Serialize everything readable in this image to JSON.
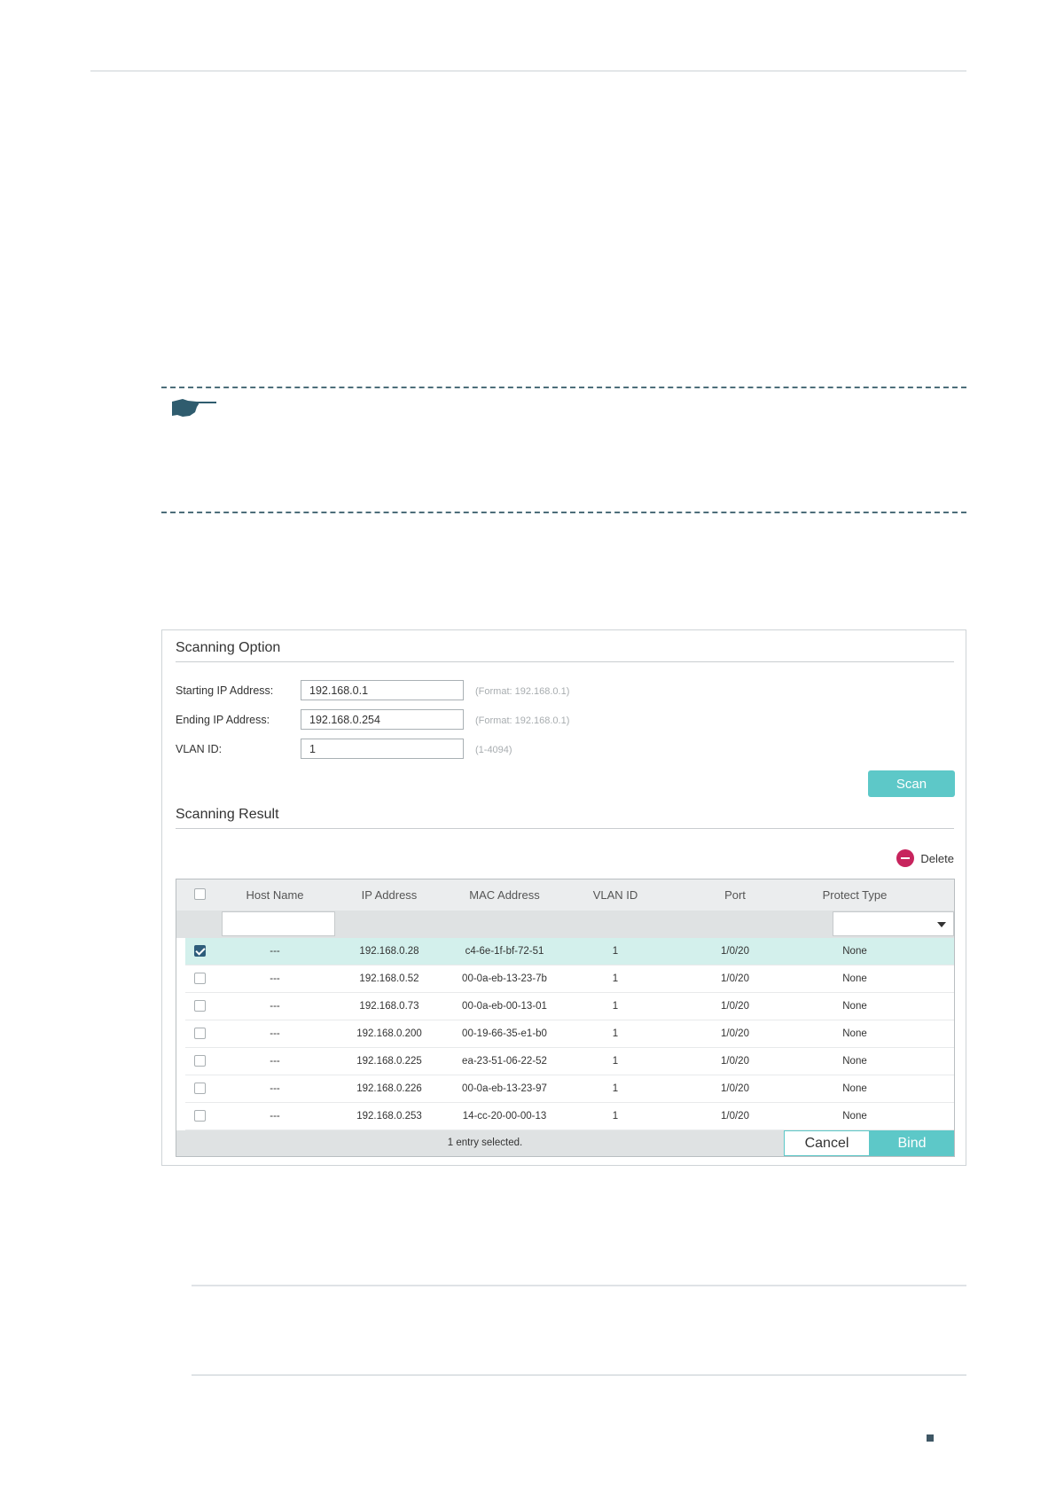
{
  "scanning_option": {
    "title": "Scanning Option",
    "fields": [
      {
        "label": "Starting IP Address:",
        "value": "192.168.0.1",
        "hint": "(Format: 192.168.0.1)"
      },
      {
        "label": "Ending IP Address:",
        "value": "192.168.0.254",
        "hint": "(Format: 192.168.0.1)"
      },
      {
        "label": "VLAN ID:",
        "value": "1",
        "hint": "(1-4094)"
      }
    ],
    "scan_label": "Scan"
  },
  "scanning_result": {
    "title": "Scanning Result",
    "delete_label": "Delete",
    "columns": [
      "Host Name",
      "IP Address",
      "MAC Address",
      "VLAN ID",
      "Port",
      "Protect Type"
    ],
    "rows": [
      {
        "selected": true,
        "host": "---",
        "ip": "192.168.0.28",
        "mac": "c4-6e-1f-bf-72-51",
        "vlan": "1",
        "port": "1/0/20",
        "protect": "None"
      },
      {
        "selected": false,
        "host": "---",
        "ip": "192.168.0.52",
        "mac": "00-0a-eb-13-23-7b",
        "vlan": "1",
        "port": "1/0/20",
        "protect": "None"
      },
      {
        "selected": false,
        "host": "---",
        "ip": "192.168.0.73",
        "mac": "00-0a-eb-00-13-01",
        "vlan": "1",
        "port": "1/0/20",
        "protect": "None"
      },
      {
        "selected": false,
        "host": "---",
        "ip": "192.168.0.200",
        "mac": "00-19-66-35-e1-b0",
        "vlan": "1",
        "port": "1/0/20",
        "protect": "None"
      },
      {
        "selected": false,
        "host": "---",
        "ip": "192.168.0.225",
        "mac": "ea-23-51-06-22-52",
        "vlan": "1",
        "port": "1/0/20",
        "protect": "None"
      },
      {
        "selected": false,
        "host": "---",
        "ip": "192.168.0.226",
        "mac": "00-0a-eb-13-23-97",
        "vlan": "1",
        "port": "1/0/20",
        "protect": "None"
      },
      {
        "selected": false,
        "host": "---",
        "ip": "192.168.0.253",
        "mac": "14-cc-20-00-00-13",
        "vlan": "1",
        "port": "1/0/20",
        "protect": "None"
      }
    ],
    "status": "1 entry selected.",
    "cancel_label": "Cancel",
    "bind_label": "Bind"
  },
  "icons": [
    "note-hand-icon",
    "delete-minus-icon",
    "dropdown-caret-icon",
    "checkbox-icon"
  ],
  "colors": {
    "accent": "#5dc8c8",
    "delete": "#c7245d",
    "selected_row": "#d3f0ec",
    "checkbox_checked": "#2e5d7b",
    "rule_dash": "#4d6e7a"
  }
}
